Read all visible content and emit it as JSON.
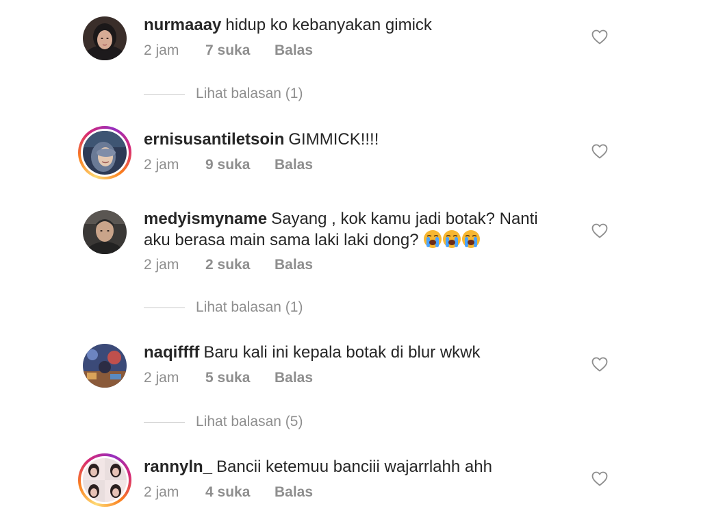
{
  "comments": [
    {
      "username": "nurmaaay",
      "text": "hidup ko kebanyakan gimick",
      "time": "2 jam",
      "likes": "7 suka",
      "reply_label": "Balas",
      "has_story_ring": false,
      "view_replies": "Lihat balasan (1)"
    },
    {
      "username": "ernisusantiletsoin",
      "text": "GIMMICK!!!!",
      "time": "2 jam",
      "likes": "9 suka",
      "reply_label": "Balas",
      "has_story_ring": true
    },
    {
      "username": "medyismyname",
      "text": "Sayang , kok kamu jadi botak? Nanti aku berasa main sama laki laki dong?",
      "emoji": "loudly-crying-face x3",
      "time": "2 jam",
      "likes": "2 suka",
      "reply_label": "Balas",
      "has_story_ring": false,
      "view_replies": "Lihat balasan (1)"
    },
    {
      "username": "naqiffff",
      "text": "Baru kali ini kepala botak di blur wkwk",
      "time": "2 jam",
      "likes": "5 suka",
      "reply_label": "Balas",
      "has_story_ring": false,
      "view_replies": "Lihat balasan (5)"
    },
    {
      "username": "rannyln_",
      "text": "Bancii ketemuu banciii wajarrlahh ahh",
      "time": "2 jam",
      "likes": "4 suka",
      "reply_label": "Balas",
      "has_story_ring": true
    }
  ],
  "colors": {
    "text_primary": "#262626",
    "text_secondary": "#8e8e8e",
    "divider": "#c7c7c7"
  },
  "icons": {
    "like": "heart-outline-icon"
  }
}
